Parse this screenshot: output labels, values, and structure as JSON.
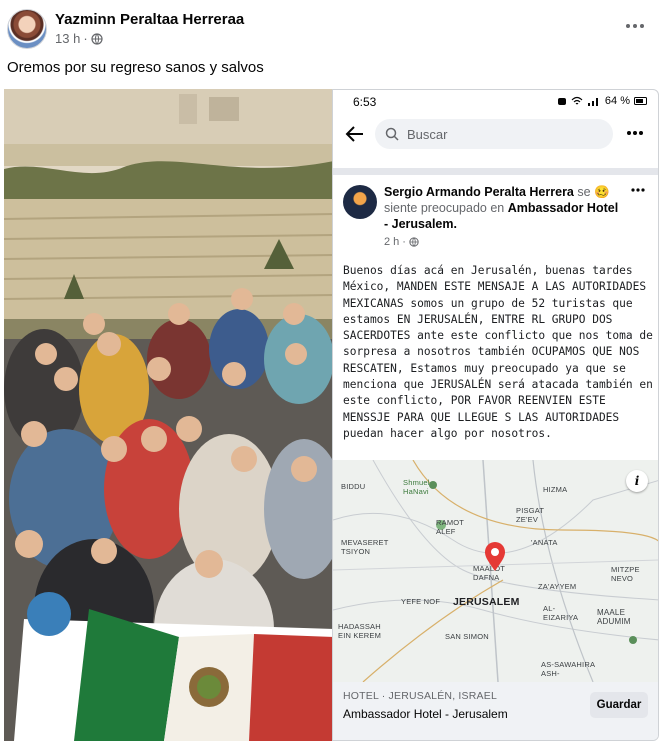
{
  "post": {
    "author": "Yazminn Peraltaa Herreraa",
    "time": "13 h",
    "separator": "·",
    "caption": "Oremos por  su regreso  sanos y salvos"
  },
  "phone": {
    "status": {
      "time": "6:53",
      "battery": "64 %"
    },
    "search": {
      "placeholder": "Buscar"
    },
    "inner_post": {
      "author": "Sergio Armando Peralta Herrera",
      "feeling_prefix": "se",
      "feeling_text": "siente preocupado en",
      "location": "Ambassador Hotel - Jerusalem.",
      "time": "2 h",
      "body": "Buenos días acá en Jerusalén, buenas tardes México, MANDEN ESTE MENSAJE A LAS AUTORIDADES MEXICANAS somos un grupo de 52 turistas que estamos EN JERUSALÉN, ENTRE RL GRUPO DOS SACERDOTES ante este conflicto que nos toma de sorpresa a nosotros también OCUPAMOS QUE NOS RESCATEN, Estamos muy preocupado ya que se menciona que JERUSALÉN será atacada también en este conflicto, POR FAVOR REENVIEN ESTE MENSSJE PARA QUE LLEGUE S LAS AUTORIDADES puedan hacer algo por nosotros."
    },
    "map": {
      "labels": {
        "biddu": "BIDDU",
        "shmuel": "Shmuel HaNavi",
        "hizma": "HIZMA",
        "pisgat": "PISGAT ZE'EV",
        "ramot": "RAMOT ALEF",
        "anata": "'ANATA",
        "mevaseret": "MEVASERET TSIYON",
        "maalot": "MAALOT DAFNA",
        "zayyem": "ZA'AYYEM",
        "mitzpe": "MITZPE NEVO",
        "yefe_nof": "YEFE NOF",
        "jerusalem": "JERUSALEM",
        "maale": "MAALE ADUMIM",
        "eizariya": "AL-EIZARIYA",
        "hadassah": "HADASSAH EIN KEREM",
        "san_simon": "SAN SIMON",
        "sawahira": "AS-SAWAHIRA ASH-"
      },
      "info_label": "i"
    },
    "place": {
      "category": "HOTEL · JERUSALÉN, ISRAEL",
      "name": "Ambassador Hotel - Jerusalem",
      "save_label": "Guardar"
    }
  },
  "colors": {
    "fb_text": "#050505",
    "fb_secondary": "#65676b",
    "search_bg": "#f0f2f5",
    "pin_red": "#e53935"
  }
}
